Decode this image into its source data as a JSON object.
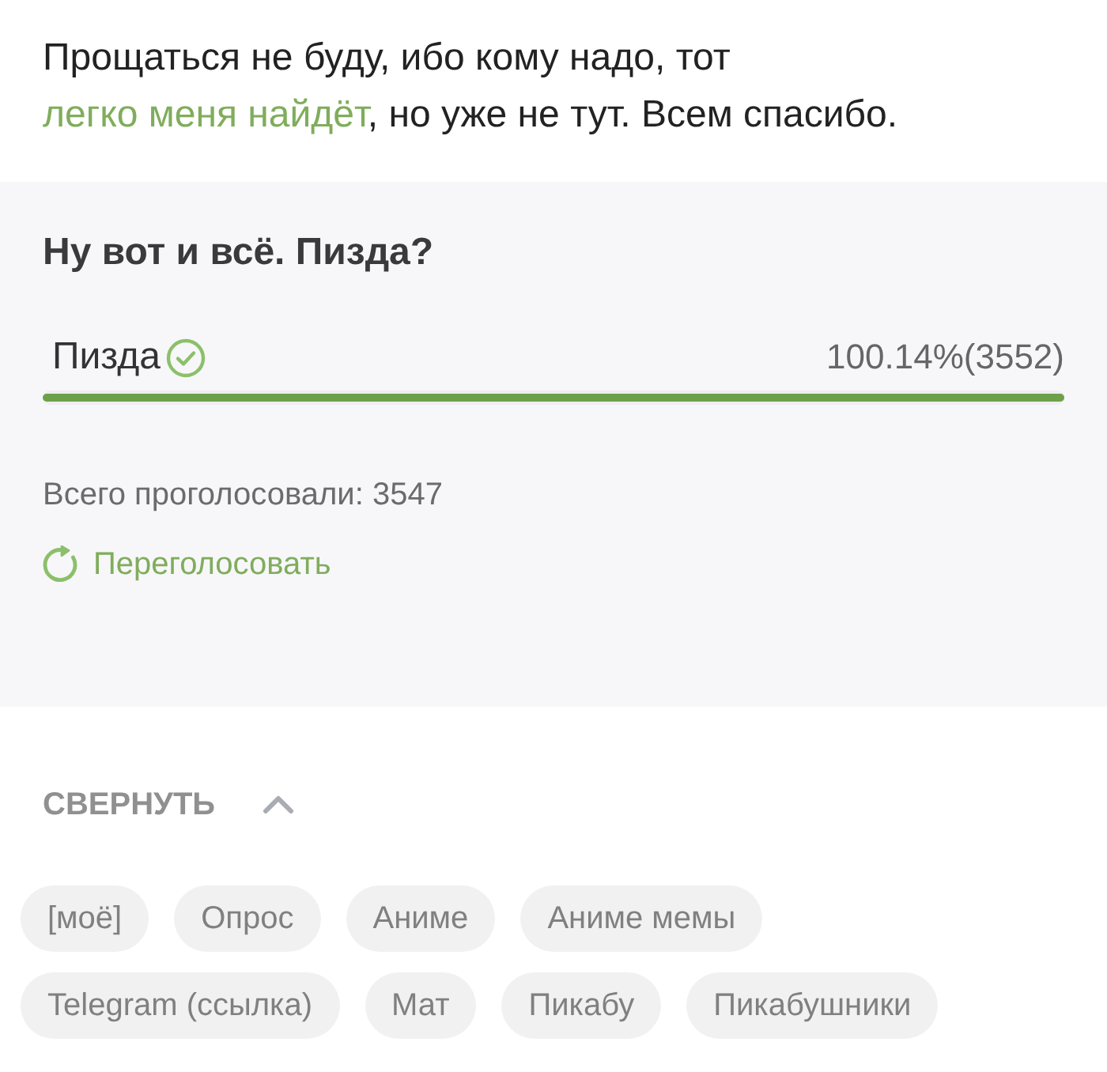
{
  "post_text": [
    {
      "kind": "text",
      "text": "Прощаться не буду, ибо кому надо, тот "
    },
    {
      "kind": "link",
      "text": "легко меня найдёт"
    },
    {
      "kind": "text",
      "text": ", но уже не тут. Всем спасибо."
    }
  ],
  "poll": {
    "title": "Ну вот и всё. Пизда?",
    "options": [
      {
        "label": "Пизда",
        "voted": true,
        "result": "100.14%(3552)",
        "level": 1
      }
    ],
    "total": "Всего проголосовали: 3547",
    "revote": "Переголосовать"
  },
  "collapse": {
    "label": "СВЕРНУТЬ",
    "expanded": true
  },
  "tags": [
    "[моё]",
    "Опрос",
    "Аниме",
    "Аниме мемы",
    "Telegram (ссылка)",
    "Мат",
    "Пикабу",
    "Пикабушники"
  ]
}
